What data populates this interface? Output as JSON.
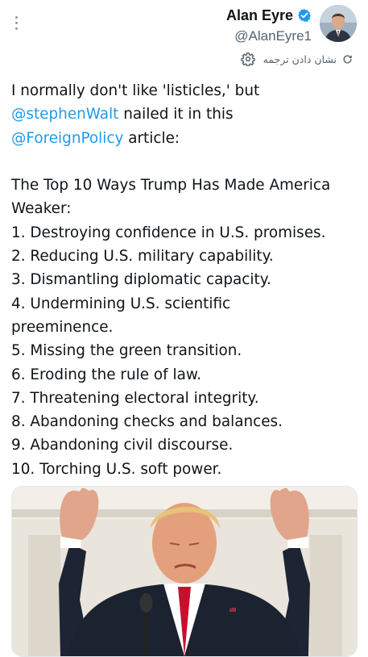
{
  "header": {
    "display_name": "Alan Eyre",
    "handle": "@AlanEyre1",
    "verified_icon": "verified-badge-icon",
    "more_icon": "more-options-icon"
  },
  "translate": {
    "label": "نشان دادن ترجمه",
    "icon": "translate-icon",
    "settings_icon": "gear-icon"
  },
  "tweet": {
    "intro": [
      "I normally don't like 'listicles,' but"
    ],
    "mention_1": "@stephenWalt",
    "mention_1_rest": " nailed it in this",
    "mention_2": "@ForeignPolicy",
    "mention_2_rest": " article:",
    "title_line_1": "The Top 10 Ways Trump Has Made America",
    "title_line_2": "Weaker:",
    "items": [
      "1. Destroying confidence in U.S. promises.",
      "2. Reducing U.S. military capability.",
      "3. Dismantling diplomatic capacity.",
      "4. Undermining U.S. scientific",
      "preeminence.",
      "5. Missing the green transition.",
      "6. Eroding the rule of law.",
      "7. Threatening electoral integrity.",
      "8. Abandoning checks and balances.",
      "9. Abandoning civil discourse.",
      "10. Torching U.S. soft power."
    ]
  },
  "colors": {
    "link": "#1d9bf0",
    "text": "#0f1419",
    "muted": "#536471"
  }
}
